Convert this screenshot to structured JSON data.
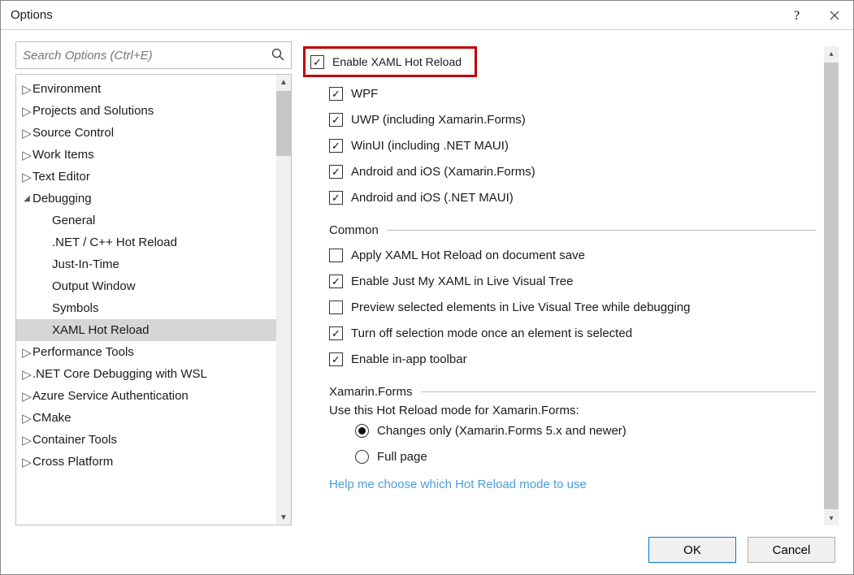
{
  "window": {
    "title": "Options"
  },
  "search": {
    "placeholder": "Search Options (Ctrl+E)"
  },
  "tree": {
    "items": [
      {
        "label": "Environment",
        "expanded": false
      },
      {
        "label": "Projects and Solutions",
        "expanded": false
      },
      {
        "label": "Source Control",
        "expanded": false
      },
      {
        "label": "Work Items",
        "expanded": false
      },
      {
        "label": "Text Editor",
        "expanded": false
      },
      {
        "label": "Debugging",
        "expanded": true,
        "children": [
          {
            "label": "General"
          },
          {
            "label": ".NET / C++ Hot Reload"
          },
          {
            "label": "Just-In-Time"
          },
          {
            "label": "Output Window"
          },
          {
            "label": "Symbols"
          },
          {
            "label": "XAML Hot Reload",
            "selected": true
          }
        ]
      },
      {
        "label": "Performance Tools",
        "expanded": false
      },
      {
        "label": ".NET Core Debugging with WSL",
        "expanded": false
      },
      {
        "label": "Azure Service Authentication",
        "expanded": false
      },
      {
        "label": "CMake",
        "expanded": false
      },
      {
        "label": "Container Tools",
        "expanded": false
      },
      {
        "label": "Cross Platform",
        "expanded": false
      }
    ]
  },
  "main": {
    "enable_label": "Enable XAML Hot Reload",
    "platforms": [
      {
        "label": "WPF",
        "checked": true
      },
      {
        "label": "UWP (including Xamarin.Forms)",
        "checked": true
      },
      {
        "label": "WinUI (including .NET MAUI)",
        "checked": true
      },
      {
        "label": "Android and iOS (Xamarin.Forms)",
        "checked": true
      },
      {
        "label": "Android and iOS (.NET MAUI)",
        "checked": true
      }
    ],
    "common": {
      "header": "Common",
      "items": [
        {
          "label": "Apply XAML Hot Reload on document save",
          "checked": false
        },
        {
          "label": "Enable Just My XAML in Live Visual Tree",
          "checked": true
        },
        {
          "label": "Preview selected elements in Live Visual Tree while debugging",
          "checked": false
        },
        {
          "label": "Turn off selection mode once an element is selected",
          "checked": true
        },
        {
          "label": "Enable in-app toolbar",
          "checked": true
        }
      ]
    },
    "xamarin": {
      "header": "Xamarin.Forms",
      "hint": "Use this Hot Reload mode for Xamarin.Forms:",
      "options": [
        {
          "label": "Changes only (Xamarin.Forms 5.x and newer)",
          "checked": true
        },
        {
          "label": "Full page",
          "checked": false
        }
      ],
      "help": "Help me choose which Hot Reload mode to use"
    }
  },
  "footer": {
    "ok": "OK",
    "cancel": "Cancel"
  }
}
